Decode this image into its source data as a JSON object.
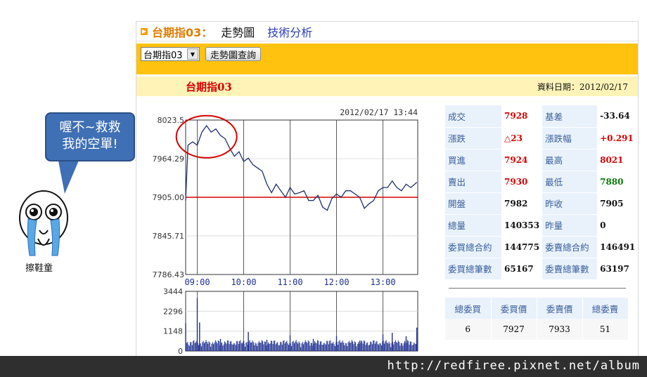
{
  "header": {
    "bullet_icon": "triangle-right-icon",
    "title": "台期指03：",
    "link_trend": "走勢圖",
    "link_tech": "技術分析"
  },
  "query": {
    "selected": "台期指03",
    "button": "走勢圖查詢"
  },
  "title_bar": {
    "name": "台期指03",
    "date": "資料日期：2012/02/17"
  },
  "chart_data": [
    {
      "type": "line",
      "title": "2012/02/17 13:44",
      "y_tick_labels": [
        "8023.5",
        "7964.29",
        "7905.00",
        "7845.71",
        "7786.43"
      ],
      "x_tick_labels": [
        "09:00",
        "10:00",
        "11:00",
        "12:00",
        "13:00"
      ],
      "ylim": [
        7786.43,
        8023.57
      ],
      "reference_line": 7905.0,
      "x": [
        8.75,
        8.8,
        8.9,
        9.0,
        9.1,
        9.2,
        9.3,
        9.4,
        9.5,
        9.6,
        9.7,
        9.8,
        9.9,
        10.0,
        10.1,
        10.2,
        10.3,
        10.4,
        10.5,
        10.6,
        10.7,
        10.8,
        10.9,
        11.0,
        11.1,
        11.2,
        11.3,
        11.4,
        11.5,
        11.6,
        11.7,
        11.8,
        11.9,
        12.0,
        12.1,
        12.2,
        12.3,
        12.4,
        12.5,
        12.6,
        12.7,
        12.8,
        12.9,
        13.0,
        13.1,
        13.2,
        13.3,
        13.4,
        13.5,
        13.6,
        13.73
      ],
      "values": [
        7900,
        7985,
        7990,
        7985,
        8005,
        8015,
        8005,
        8010,
        8000,
        7995,
        7980,
        7968,
        7975,
        7960,
        7965,
        7955,
        7950,
        7945,
        7925,
        7912,
        7925,
        7915,
        7905,
        7920,
        7910,
        7912,
        7915,
        7900,
        7900,
        7908,
        7890,
        7885,
        7903,
        7910,
        7905,
        7915,
        7915,
        7910,
        7905,
        7888,
        7895,
        7900,
        7915,
        7920,
        7920,
        7930,
        7920,
        7915,
        7925,
        7920,
        7928
      ]
    },
    {
      "type": "bar",
      "title": "",
      "y_tick_labels": [
        "3444",
        "2296",
        "1148",
        "0"
      ],
      "ylim": [
        0,
        3444
      ],
      "x": [
        8.75,
        9.0,
        9.05,
        9.5,
        10.0,
        10.1,
        10.5,
        11.0,
        11.5,
        12.0,
        12.5,
        13.0,
        13.2,
        13.5,
        13.73
      ],
      "values": [
        1600,
        3050,
        1650,
        700,
        600,
        1100,
        650,
        900,
        700,
        850,
        600,
        950,
        1050,
        850,
        1350
      ]
    }
  ],
  "quote": {
    "rows": [
      {
        "l1": "成交",
        "v1": "7928",
        "c1": "red",
        "l2": "基差",
        "v2": "-33.64",
        "c2": "black"
      },
      {
        "l1": "漲跌",
        "v1": "△23",
        "c1": "red",
        "l2": "漲跌幅",
        "v2": "+0.291",
        "c2": "red"
      },
      {
        "l1": "買進",
        "v1": "7924",
        "c1": "red",
        "l2": "最高",
        "v2": "8021",
        "c2": "red"
      },
      {
        "l1": "賣出",
        "v1": "7930",
        "c1": "red",
        "l2": "最低",
        "v2": "7880",
        "c2": "green"
      },
      {
        "l1": "開盤",
        "v1": "7982",
        "c1": "black",
        "l2": "昨收",
        "v2": "7905",
        "c2": "black"
      },
      {
        "l1": "總量",
        "v1": "140353",
        "c1": "black",
        "l2": "昨量",
        "v2": "0",
        "c2": "black"
      },
      {
        "l1": "委買總合約",
        "v1": "144775",
        "c1": "black",
        "l2": "委賣總合約",
        "v2": "146491",
        "c2": "black"
      },
      {
        "l1": "委買總筆數",
        "v1": "65167",
        "c1": "black",
        "l2": "委賣總筆數",
        "v2": "63197",
        "c2": "black"
      }
    ]
  },
  "summary": {
    "headers": [
      "總委買",
      "委買價",
      "委賣價",
      "總委賣"
    ],
    "values": [
      "6",
      "7927",
      "7933",
      "51"
    ]
  },
  "meme": {
    "bubble_text_line1": "喔不~救救",
    "bubble_text_line2": "我的空單!",
    "label": "擦鞋童"
  },
  "footer": {
    "url": "http://redfiree.pixnet.net/album"
  },
  "colors": {
    "accent": "#ffc20e",
    "title_bar": "#fff3b8",
    "line": "#1e2f6b",
    "reference": "#d40000",
    "volume": "#1e2f8f"
  }
}
